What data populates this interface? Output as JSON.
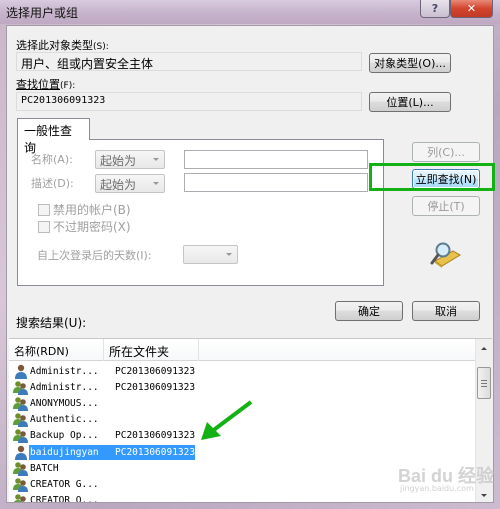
{
  "window": {
    "title": "选择用户或组",
    "help_glyph": "?",
    "close_glyph": "✕"
  },
  "object_type": {
    "label": "选择此对象类型",
    "label_hotkey": "(S):",
    "value": "用户、组或内置安全主体",
    "button": "对象类型(O)..."
  },
  "location": {
    "label": "查找位置",
    "label_hotkey": "(F):",
    "value": "PC201306091323",
    "button": "位置(L)..."
  },
  "tab": {
    "label": "一般性查询"
  },
  "query": {
    "name_label": "名称(A):",
    "name_mode": "起始为",
    "name_value": "",
    "desc_label": "描述(D):",
    "desc_mode": "起始为",
    "desc_value": "",
    "disabled_accounts": "禁用的帐户(B)",
    "disabled_accounts_checked": false,
    "non_expiring_pw": "不过期密码(X)",
    "non_expiring_pw_checked": false,
    "days_since_login_label": "自上次登录后的天数(I):",
    "days_since_login_value": ""
  },
  "side_buttons": {
    "columns": "列(C)...",
    "find_now": "立即查找(N)",
    "stop": "停止(T)"
  },
  "dialog_buttons": {
    "ok": "确定",
    "cancel": "取消"
  },
  "results": {
    "label": "搜索结果(U):",
    "columns": [
      "名称(RDN)",
      "所在文件夹"
    ],
    "rows": [
      {
        "icon": "user",
        "name": "Administr...",
        "folder": "PC201306091323",
        "selected": false
      },
      {
        "icon": "group",
        "name": "Administr...",
        "folder": "PC201306091323",
        "selected": false
      },
      {
        "icon": "group",
        "name": "ANONYMOUS...",
        "folder": "",
        "selected": false
      },
      {
        "icon": "group",
        "name": "Authentic...",
        "folder": "",
        "selected": false
      },
      {
        "icon": "group",
        "name": "Backup Op...",
        "folder": "PC201306091323",
        "selected": false
      },
      {
        "icon": "user",
        "name": "baidujingyan",
        "folder": "PC201306091323",
        "selected": true
      },
      {
        "icon": "group",
        "name": "BATCH",
        "folder": "",
        "selected": false
      },
      {
        "icon": "group",
        "name": "CREATOR G...",
        "folder": "",
        "selected": false
      },
      {
        "icon": "group",
        "name": "CREATOR O...",
        "folder": "",
        "selected": false
      }
    ]
  },
  "annotation": {
    "highlight_color": "#13b113",
    "arrow_color": "#13b113"
  },
  "watermark": {
    "main": "Bai du 经验",
    "sub": "jingyan.baidu.com"
  },
  "colors": {
    "selection": "#3399ff",
    "close_button": "#c94532"
  }
}
